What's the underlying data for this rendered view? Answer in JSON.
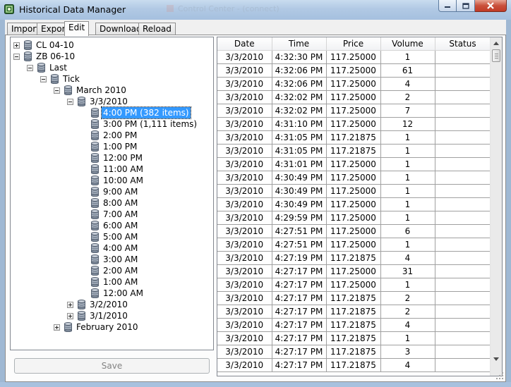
{
  "window": {
    "title": "Historical Data Manager",
    "background_title": "Control Center - (connect)"
  },
  "tabs": [
    {
      "label": "Import"
    },
    {
      "label": "Export"
    },
    {
      "label": "Edit",
      "active": true
    },
    {
      "label": "Download"
    },
    {
      "label": "Reload"
    }
  ],
  "tree": {
    "nodes": [
      {
        "label": "CL 04-10",
        "expander": "plus",
        "icon": "database-icon"
      },
      {
        "label": "ZB 06-10",
        "expander": "minus",
        "icon": "database-icon"
      },
      {
        "label": "Last",
        "expander": "minus",
        "icon": "database-icon"
      },
      {
        "label": "Tick",
        "expander": "minus",
        "icon": "database-icon"
      },
      {
        "label": "March 2010",
        "expander": "minus",
        "icon": "database-icon"
      },
      {
        "label": "3/3/2010",
        "expander": "minus",
        "icon": "database-icon"
      },
      {
        "label": "4:00 PM (382 items)",
        "selected": true,
        "icon": "database-icon"
      },
      {
        "label": "3:00 PM (1,111 items)",
        "icon": "database-icon"
      },
      {
        "label": "2:00 PM",
        "icon": "database-icon"
      },
      {
        "label": "1:00 PM",
        "icon": "database-icon"
      },
      {
        "label": "12:00 PM",
        "icon": "database-icon"
      },
      {
        "label": "11:00 AM",
        "icon": "database-icon"
      },
      {
        "label": "10:00 AM",
        "icon": "database-icon"
      },
      {
        "label": "9:00 AM",
        "icon": "database-icon"
      },
      {
        "label": "8:00 AM",
        "icon": "database-icon"
      },
      {
        "label": "7:00 AM",
        "icon": "database-icon"
      },
      {
        "label": "6:00 AM",
        "icon": "database-icon"
      },
      {
        "label": "5:00 AM",
        "icon": "database-icon"
      },
      {
        "label": "4:00 AM",
        "icon": "database-icon"
      },
      {
        "label": "3:00 AM",
        "icon": "database-icon"
      },
      {
        "label": "2:00 AM",
        "icon": "database-icon"
      },
      {
        "label": "1:00 AM",
        "icon": "database-icon"
      },
      {
        "label": "12:00 AM",
        "icon": "database-icon"
      },
      {
        "label": "3/2/2010",
        "expander": "plus",
        "icon": "database-icon"
      },
      {
        "label": "3/1/2010",
        "expander": "plus",
        "icon": "database-icon"
      },
      {
        "label": "February 2010",
        "expander": "plus",
        "icon": "database-icon"
      }
    ]
  },
  "save_button": {
    "label": "Save",
    "enabled": false
  },
  "grid": {
    "columns": [
      "Date",
      "Time",
      "Price",
      "Volume",
      "Status"
    ],
    "rows": [
      [
        "3/3/2010",
        "4:32:30 PM",
        "117.25000",
        "1",
        ""
      ],
      [
        "3/3/2010",
        "4:32:06 PM",
        "117.25000",
        "61",
        ""
      ],
      [
        "3/3/2010",
        "4:32:06 PM",
        "117.25000",
        "4",
        ""
      ],
      [
        "3/3/2010",
        "4:32:02 PM",
        "117.25000",
        "2",
        ""
      ],
      [
        "3/3/2010",
        "4:32:02 PM",
        "117.25000",
        "7",
        ""
      ],
      [
        "3/3/2010",
        "4:31:10 PM",
        "117.25000",
        "12",
        ""
      ],
      [
        "3/3/2010",
        "4:31:05 PM",
        "117.21875",
        "1",
        ""
      ],
      [
        "3/3/2010",
        "4:31:05 PM",
        "117.21875",
        "1",
        ""
      ],
      [
        "3/3/2010",
        "4:31:01 PM",
        "117.25000",
        "1",
        ""
      ],
      [
        "3/3/2010",
        "4:30:49 PM",
        "117.25000",
        "1",
        ""
      ],
      [
        "3/3/2010",
        "4:30:49 PM",
        "117.25000",
        "1",
        ""
      ],
      [
        "3/3/2010",
        "4:30:49 PM",
        "117.25000",
        "1",
        ""
      ],
      [
        "3/3/2010",
        "4:29:59 PM",
        "117.25000",
        "1",
        ""
      ],
      [
        "3/3/2010",
        "4:27:51 PM",
        "117.25000",
        "6",
        ""
      ],
      [
        "3/3/2010",
        "4:27:51 PM",
        "117.25000",
        "1",
        ""
      ],
      [
        "3/3/2010",
        "4:27:19 PM",
        "117.21875",
        "4",
        ""
      ],
      [
        "3/3/2010",
        "4:27:17 PM",
        "117.25000",
        "31",
        ""
      ],
      [
        "3/3/2010",
        "4:27:17 PM",
        "117.25000",
        "1",
        ""
      ],
      [
        "3/3/2010",
        "4:27:17 PM",
        "117.21875",
        "2",
        ""
      ],
      [
        "3/3/2010",
        "4:27:17 PM",
        "117.21875",
        "2",
        ""
      ],
      [
        "3/3/2010",
        "4:27:17 PM",
        "117.21875",
        "4",
        ""
      ],
      [
        "3/3/2010",
        "4:27:17 PM",
        "117.21875",
        "1",
        ""
      ],
      [
        "3/3/2010",
        "4:27:17 PM",
        "117.21875",
        "3",
        ""
      ],
      [
        "3/3/2010",
        "4:27:17 PM",
        "117.21875",
        "4",
        ""
      ]
    ]
  },
  "colors": {
    "selection": "#3399ff",
    "title_bar": "#b1c9e4",
    "close_button": "#c9503b",
    "grid_lines": "#a0a0a0"
  }
}
